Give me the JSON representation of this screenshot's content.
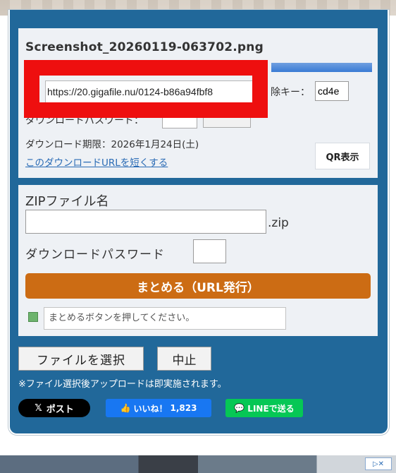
{
  "file": {
    "name": "Screenshot_20260119-063702.png",
    "url": "https://20.gigafile.nu/0124-b86a94fbf8",
    "delete_key_label": "除キー：",
    "delete_key": "cd4e",
    "password_label_partial": "ダウンロードパスワード：",
    "expiry": "ダウンロード期限：2026年1月24日(土)",
    "shorten_link": "このダウンロードURLを短くする",
    "qr_button": "QR表示"
  },
  "bundle": {
    "zip_label": "ZIPファイル名",
    "zip_ext": ".zip",
    "password_label": "ダウンロードパスワード",
    "bundle_button": "まとめる（URL発行）",
    "message_placeholder": "まとめるボタンを押してください。"
  },
  "controls": {
    "select_file": "ファイルを選択",
    "stop": "中止",
    "note": "※ファイル選択後アップロードは即実施されます。"
  },
  "social": {
    "x_post": "ポスト",
    "like": "いいね！",
    "like_count": "1,823",
    "line": "LINEで送る"
  },
  "colors": {
    "panel": "#21689a",
    "bundle_button": "#cc6c14",
    "highlight": "#ee0f0f"
  }
}
